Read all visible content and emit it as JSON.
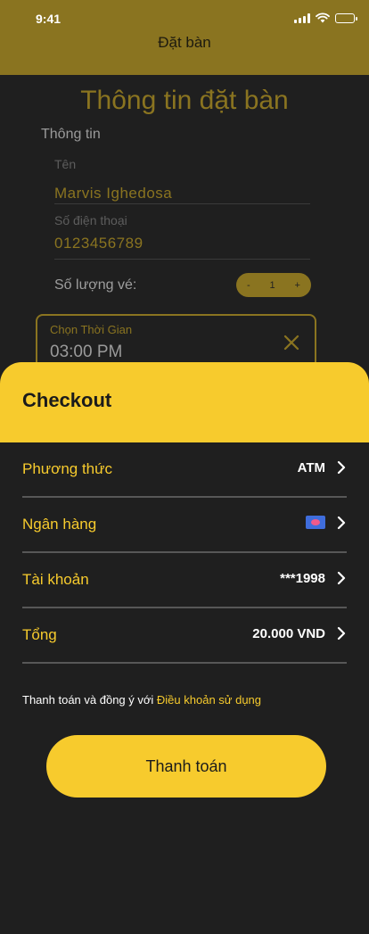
{
  "status_bar": {
    "time": "9:41"
  },
  "header": {
    "title": "Đặt bàn"
  },
  "form": {
    "title": "Thông tin đặt bàn",
    "section_label": "Thông tin",
    "name_label": "Tên",
    "name_value": "Marvis Ighedosa",
    "phone_label": "Số điện thoại",
    "phone_value": "0123456789",
    "quantity_label": "Số lượng vé:",
    "quantity_minus": "-",
    "quantity_value": "1",
    "quantity_plus": "+",
    "time_label": "Chọn Thời Gian",
    "time_value": "03:00 PM"
  },
  "checkout": {
    "title": "Checkout",
    "rows": [
      {
        "label": "Phương thức",
        "value": "ATM"
      },
      {
        "label": "Ngân hàng",
        "value": "",
        "icon": "credit-card-icon"
      },
      {
        "label": "Tài khoản",
        "value": "***1998"
      },
      {
        "label": "Tổng",
        "value": "20.000 VND"
      }
    ],
    "terms_text": "Thanh toán và đồng ý với ",
    "terms_link": "Điều khoản sử dụng",
    "pay_button": "Thanh toán"
  },
  "colors": {
    "accent": "#f7cb2d",
    "accent_dim": "#8a7420",
    "background": "#1f1f1f"
  }
}
